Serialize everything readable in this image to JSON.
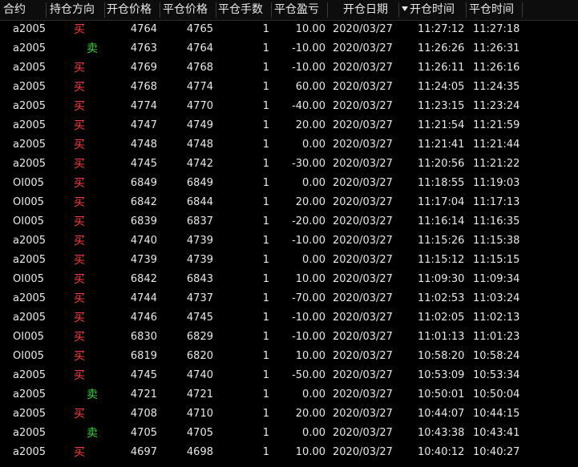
{
  "headers": [
    "合约",
    "持仓方向",
    "开仓价格",
    "平仓价格",
    "平仓手数",
    "平仓盈亏",
    "开仓日期",
    "开仓时间",
    "平仓时间"
  ],
  "colors": {
    "buy": "#ff3b3b",
    "sell": "#3fcf3f",
    "text": "#e8e8e8",
    "background": "#000000"
  },
  "sort_icon": "sort-descending-icon",
  "rows": [
    {
      "contract": "a2005",
      "direction": "买",
      "open_price": "4764",
      "close_price": "4765",
      "lots": "1",
      "pnl": "10.00",
      "open_date": "2020/03/27",
      "open_time": "11:27:12",
      "close_time": "11:27:18"
    },
    {
      "contract": "a2005",
      "direction": "卖",
      "open_price": "4763",
      "close_price": "4764",
      "lots": "1",
      "pnl": "-10.00",
      "open_date": "2020/03/27",
      "open_time": "11:26:26",
      "close_time": "11:26:31"
    },
    {
      "contract": "a2005",
      "direction": "买",
      "open_price": "4769",
      "close_price": "4768",
      "lots": "1",
      "pnl": "-10.00",
      "open_date": "2020/03/27",
      "open_time": "11:26:11",
      "close_time": "11:26:16"
    },
    {
      "contract": "a2005",
      "direction": "买",
      "open_price": "4768",
      "close_price": "4774",
      "lots": "1",
      "pnl": "60.00",
      "open_date": "2020/03/27",
      "open_time": "11:24:05",
      "close_time": "11:24:35"
    },
    {
      "contract": "a2005",
      "direction": "买",
      "open_price": "4774",
      "close_price": "4770",
      "lots": "1",
      "pnl": "-40.00",
      "open_date": "2020/03/27",
      "open_time": "11:23:15",
      "close_time": "11:23:24"
    },
    {
      "contract": "a2005",
      "direction": "买",
      "open_price": "4747",
      "close_price": "4749",
      "lots": "1",
      "pnl": "20.00",
      "open_date": "2020/03/27",
      "open_time": "11:21:54",
      "close_time": "11:21:59"
    },
    {
      "contract": "a2005",
      "direction": "买",
      "open_price": "4748",
      "close_price": "4748",
      "lots": "1",
      "pnl": "0.00",
      "open_date": "2020/03/27",
      "open_time": "11:21:41",
      "close_time": "11:21:44"
    },
    {
      "contract": "a2005",
      "direction": "买",
      "open_price": "4745",
      "close_price": "4742",
      "lots": "1",
      "pnl": "-30.00",
      "open_date": "2020/03/27",
      "open_time": "11:20:56",
      "close_time": "11:21:22"
    },
    {
      "contract": "OI005",
      "direction": "买",
      "open_price": "6849",
      "close_price": "6849",
      "lots": "1",
      "pnl": "0.00",
      "open_date": "2020/03/27",
      "open_time": "11:18:55",
      "close_time": "11:19:03"
    },
    {
      "contract": "OI005",
      "direction": "买",
      "open_price": "6842",
      "close_price": "6844",
      "lots": "1",
      "pnl": "20.00",
      "open_date": "2020/03/27",
      "open_time": "11:17:04",
      "close_time": "11:17:13"
    },
    {
      "contract": "OI005",
      "direction": "买",
      "open_price": "6839",
      "close_price": "6837",
      "lots": "1",
      "pnl": "-20.00",
      "open_date": "2020/03/27",
      "open_time": "11:16:14",
      "close_time": "11:16:35"
    },
    {
      "contract": "a2005",
      "direction": "买",
      "open_price": "4740",
      "close_price": "4739",
      "lots": "1",
      "pnl": "-10.00",
      "open_date": "2020/03/27",
      "open_time": "11:15:26",
      "close_time": "11:15:38"
    },
    {
      "contract": "a2005",
      "direction": "买",
      "open_price": "4739",
      "close_price": "4739",
      "lots": "1",
      "pnl": "0.00",
      "open_date": "2020/03/27",
      "open_time": "11:15:12",
      "close_time": "11:15:15"
    },
    {
      "contract": "OI005",
      "direction": "买",
      "open_price": "6842",
      "close_price": "6843",
      "lots": "1",
      "pnl": "10.00",
      "open_date": "2020/03/27",
      "open_time": "11:09:30",
      "close_time": "11:09:34"
    },
    {
      "contract": "a2005",
      "direction": "买",
      "open_price": "4744",
      "close_price": "4737",
      "lots": "1",
      "pnl": "-70.00",
      "open_date": "2020/03/27",
      "open_time": "11:02:53",
      "close_time": "11:03:24"
    },
    {
      "contract": "a2005",
      "direction": "买",
      "open_price": "4746",
      "close_price": "4745",
      "lots": "1",
      "pnl": "-10.00",
      "open_date": "2020/03/27",
      "open_time": "11:02:05",
      "close_time": "11:02:13"
    },
    {
      "contract": "OI005",
      "direction": "买",
      "open_price": "6830",
      "close_price": "6829",
      "lots": "1",
      "pnl": "-10.00",
      "open_date": "2020/03/27",
      "open_time": "11:01:13",
      "close_time": "11:01:23"
    },
    {
      "contract": "OI005",
      "direction": "买",
      "open_price": "6819",
      "close_price": "6820",
      "lots": "1",
      "pnl": "10.00",
      "open_date": "2020/03/27",
      "open_time": "10:58:20",
      "close_time": "10:58:24"
    },
    {
      "contract": "a2005",
      "direction": "买",
      "open_price": "4745",
      "close_price": "4740",
      "lots": "1",
      "pnl": "-50.00",
      "open_date": "2020/03/27",
      "open_time": "10:53:09",
      "close_time": "10:53:34"
    },
    {
      "contract": "a2005",
      "direction": "卖",
      "open_price": "4721",
      "close_price": "4721",
      "lots": "1",
      "pnl": "0.00",
      "open_date": "2020/03/27",
      "open_time": "10:50:01",
      "close_time": "10:50:04"
    },
    {
      "contract": "a2005",
      "direction": "买",
      "open_price": "4708",
      "close_price": "4710",
      "lots": "1",
      "pnl": "20.00",
      "open_date": "2020/03/27",
      "open_time": "10:44:07",
      "close_time": "10:44:15"
    },
    {
      "contract": "a2005",
      "direction": "卖",
      "open_price": "4705",
      "close_price": "4705",
      "lots": "1",
      "pnl": "0.00",
      "open_date": "2020/03/27",
      "open_time": "10:43:38",
      "close_time": "10:43:41"
    },
    {
      "contract": "a2005",
      "direction": "买",
      "open_price": "4697",
      "close_price": "4698",
      "lots": "1",
      "pnl": "10.00",
      "open_date": "2020/03/27",
      "open_time": "10:40:12",
      "close_time": "10:40:27"
    }
  ]
}
